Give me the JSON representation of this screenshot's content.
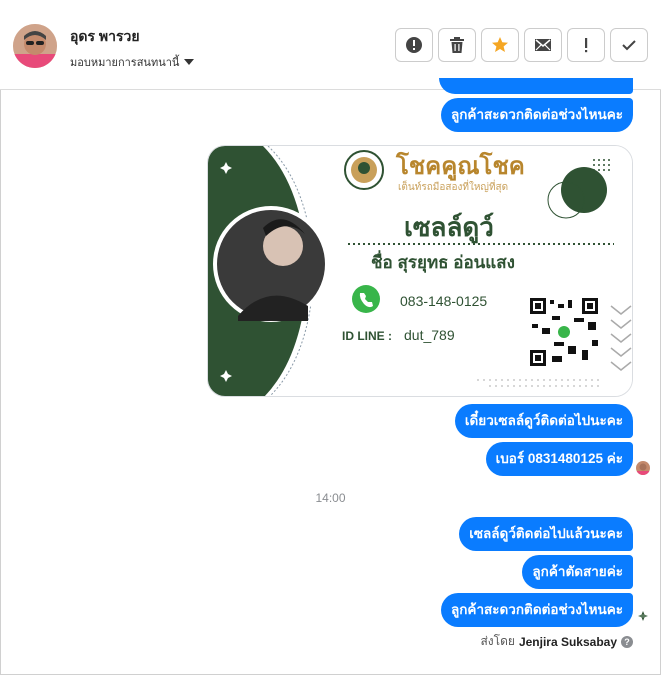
{
  "header": {
    "contact_name": "อุดร พารวย",
    "assign_label": "มอบหมายการสนทนานี้"
  },
  "toolbar": {
    "buttons": [
      {
        "name": "alert-button",
        "icon": "alert-circle-icon"
      },
      {
        "name": "delete-button",
        "icon": "trash-icon"
      },
      {
        "name": "star-button",
        "icon": "star-icon",
        "color": "#f5a623"
      },
      {
        "name": "mark-unread-button",
        "icon": "envelope-icon"
      },
      {
        "name": "important-button",
        "icon": "exclamation-icon"
      },
      {
        "name": "mark-done-button",
        "icon": "check-icon"
      }
    ]
  },
  "messages": {
    "m1": "ลูกค้าสะดวกติดต่อช่วงไหนคะ",
    "m2": "เดี๋ยวเซลล์ดูว์ติดต่อไปนะคะ",
    "m3": "เบอร์ 0831480125 ค่ะ",
    "m4": "เซลล์ดูว์ติดต่อไปแล้วนะคะ",
    "m5": "ลูกค้าตัดสายค่ะ",
    "m6": "ลูกค้าสะดวกติดต่อช่วงไหนคะ"
  },
  "time_separator": "14:00",
  "card": {
    "brand": "โชคคูณโชค",
    "tagline": "เต็นท์รถมือสองที่ใหญ่ที่สุด",
    "role": "เซลล์ดูว์",
    "person": "ชื่อ สุรยุทธ  อ่อนแสง",
    "phone": "083-148-0125",
    "line_label": "ID LINE :",
    "line_id": "dut_789"
  },
  "footer": {
    "sent_by_label": "ส่งโดย",
    "sent_by_name": "Jenjira Suksabay"
  },
  "colors": {
    "bubble": "#0a7cff",
    "card_green": "#2f5233",
    "brand_gold": "#b8862d"
  }
}
